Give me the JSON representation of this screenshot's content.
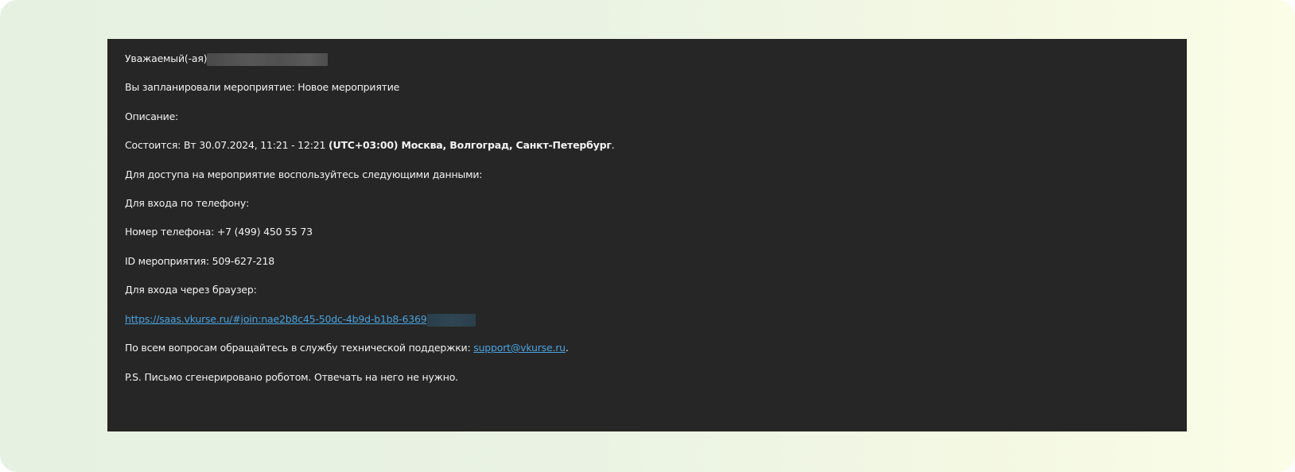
{
  "email": {
    "greeting": "Уважаемый(-ая)",
    "scheduled_text": "Вы запланировали мероприятие: Новое мероприятие",
    "description_label": "Описание:",
    "when_prefix": "Состоится: Вт 30.07.2024, 11:21 - 12:21 ",
    "when_timezone": "(UTC+03:00) Москва, Волгоград, Санкт-Петербург",
    "when_suffix": ".",
    "access_text": "Для доступа на мероприятие воспользуйтесь следующими данными:",
    "phone_entry_label": "Для входа по телефону:",
    "phone_number_text": "Номер телефона: +7 (499) 450 55 73",
    "event_id_text": "ID мероприятия: 509-627-218",
    "browser_entry_label": "Для входа через браузер:",
    "join_link": "https://saas.vkurse.ru/#join:nae2b8c45-50dc-4b9d-b1b8-6369",
    "support_text": "По всем вопросам обращайтесь в службу технической поддержки: ",
    "support_email": "support@vkurse.ru",
    "support_suffix": ".",
    "ps_text": "P.S. Письмо сгенерировано роботом. Отвечать на него не нужно."
  },
  "colors": {
    "panel_background": "#262626",
    "text": "#f2f2f2",
    "link": "#4aa3df"
  }
}
